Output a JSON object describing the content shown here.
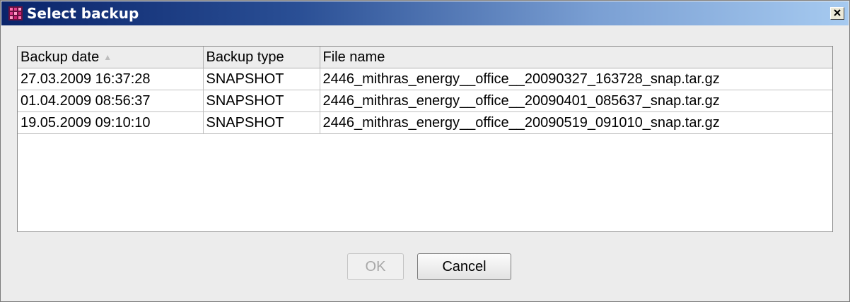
{
  "window": {
    "title": "Select backup"
  },
  "table": {
    "columns": [
      "Backup date",
      "Backup type",
      "File name"
    ],
    "rows": [
      [
        "27.03.2009 16:37:28",
        "SNAPSHOT",
        "2446_mithras_energy__office__20090327_163728_snap.tar.gz"
      ],
      [
        "01.04.2009 08:56:37",
        "SNAPSHOT",
        "2446_mithras_energy__office__20090401_085637_snap.tar.gz"
      ],
      [
        "19.05.2009 09:10:10",
        "SNAPSHOT",
        "2446_mithras_energy__office__20090519_091010_snap.tar.gz"
      ]
    ],
    "sort_indicator": "▲"
  },
  "buttons": {
    "ok": "OK",
    "cancel": "Cancel"
  },
  "icons": {
    "app": "app-logo-icon",
    "close": "close-icon"
  },
  "colors": {
    "titlebar_start": "#0a246a",
    "titlebar_end": "#a6caf0",
    "disabled_text": "#a8a8a8"
  }
}
